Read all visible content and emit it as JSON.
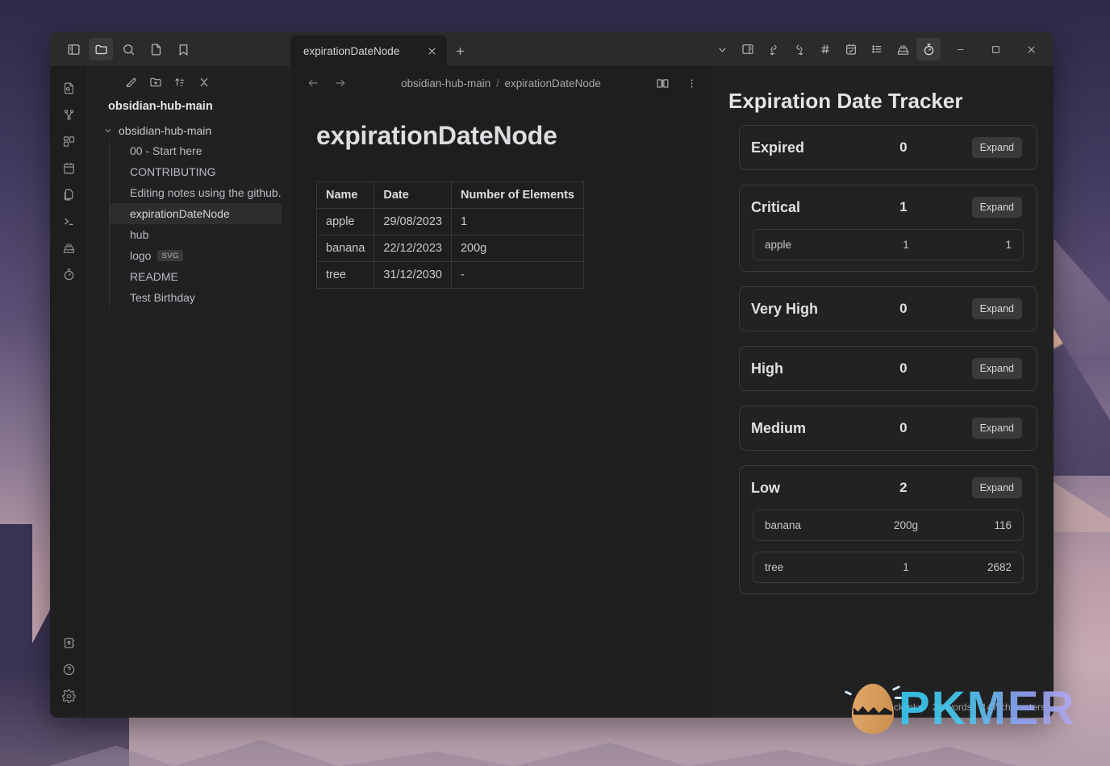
{
  "window": {
    "controls": {
      "minimize": "minimize-icon",
      "maximize": "maximize-icon",
      "close": "close-icon"
    }
  },
  "sidebar_toolbar": {
    "items": [
      {
        "name": "toggle-left-sidebar-icon",
        "label": "Toggle left sidebar"
      },
      {
        "name": "folder-icon",
        "label": "Files",
        "active": true
      },
      {
        "name": "search-icon",
        "label": "Search"
      },
      {
        "name": "file-icon",
        "label": "Recent files"
      },
      {
        "name": "bookmark-icon",
        "label": "Bookmarks"
      }
    ]
  },
  "tabs": {
    "items": [
      {
        "title": "expirationDateNode",
        "active": true
      }
    ],
    "close_label": "×",
    "new_tab_label": "+"
  },
  "top_right_toolbar": {
    "items": [
      {
        "name": "chevron-down-icon",
        "label": "More options"
      },
      {
        "name": "toggle-right-sidebar-icon",
        "label": "Toggle right sidebar"
      },
      {
        "name": "link-back-icon",
        "label": "Backlinks"
      },
      {
        "name": "link-forward-icon",
        "label": "Outgoing links"
      },
      {
        "name": "hash-tag-icon",
        "label": "Tags"
      },
      {
        "name": "calendar-check-icon",
        "label": "Tasks"
      },
      {
        "name": "list-icon",
        "label": "Outline"
      },
      {
        "name": "cake-icon",
        "label": "Birthday tracker"
      },
      {
        "name": "timer-icon",
        "label": "Expiration date tracker",
        "active": true
      }
    ]
  },
  "ribbon": {
    "top_items": [
      {
        "name": "file-search-icon",
        "label": "Quick switcher"
      },
      {
        "name": "graph-icon",
        "label": "Graph view"
      },
      {
        "name": "canvas-icon",
        "label": "Canvas"
      },
      {
        "name": "calendar-icon",
        "label": "Daily note"
      },
      {
        "name": "copy-files-icon",
        "label": "Templates"
      },
      {
        "name": "terminal-icon",
        "label": "Terminal"
      },
      {
        "name": "cake-icon",
        "label": "Birthday"
      },
      {
        "name": "timer-icon",
        "label": "Expiration tracker"
      }
    ],
    "bottom_items": [
      {
        "name": "vault-icon",
        "label": "Open another vault"
      },
      {
        "name": "help-icon",
        "label": "Help"
      },
      {
        "name": "settings-gear-icon",
        "label": "Settings"
      }
    ]
  },
  "explorer": {
    "toolbar": [
      {
        "name": "new-note-icon",
        "label": "New note"
      },
      {
        "name": "new-folder-icon",
        "label": "New folder"
      },
      {
        "name": "sort-icon",
        "label": "Change sort order"
      },
      {
        "name": "collapse-all-icon",
        "label": "Collapse all"
      }
    ],
    "vault_name": "obsidian-hub-main",
    "folder": {
      "name": "obsidian-hub-main",
      "expanded": true,
      "children": [
        {
          "label": "00 - Start here",
          "ext": null,
          "selected": false
        },
        {
          "label": "CONTRIBUTING",
          "ext": null,
          "selected": false
        },
        {
          "label": "Editing notes using the github.dev ed…",
          "ext": null,
          "selected": false
        },
        {
          "label": "expirationDateNode",
          "ext": null,
          "selected": true
        },
        {
          "label": "hub",
          "ext": null,
          "selected": false
        },
        {
          "label": "logo",
          "ext": "SVG",
          "selected": false
        },
        {
          "label": "README",
          "ext": null,
          "selected": false
        },
        {
          "label": "Test Birthday",
          "ext": null,
          "selected": false
        }
      ]
    }
  },
  "editor": {
    "nav": {
      "back": "back-arrow-icon",
      "forward": "forward-arrow-icon"
    },
    "breadcrumb": {
      "root": "obsidian-hub-main",
      "separator": "/",
      "leaf": "expirationDateNode"
    },
    "header_icons": [
      {
        "name": "reading-view-icon",
        "label": "Reading view"
      },
      {
        "name": "more-options-icon",
        "label": "More options"
      }
    ],
    "note_title": "expirationDateNode",
    "table": {
      "headers": [
        "Name",
        "Date",
        "Number of Elements"
      ],
      "rows": [
        [
          "apple",
          "29/08/2023",
          "1"
        ],
        [
          "banana",
          "22/12/2023",
          "200g"
        ],
        [
          "tree",
          "31/12/2030",
          "-"
        ]
      ]
    }
  },
  "right_panel": {
    "title": "Expiration Date Tracker",
    "expand_label": "Expand",
    "groups": [
      {
        "label": "Expired",
        "count": "0",
        "items": []
      },
      {
        "label": "Critical",
        "count": "1",
        "items": [
          {
            "name": "apple",
            "middle": "1",
            "right": "1"
          }
        ]
      },
      {
        "label": "Very High",
        "count": "0",
        "items": []
      },
      {
        "label": "High",
        "count": "0",
        "items": []
      },
      {
        "label": "Medium",
        "count": "0",
        "items": []
      },
      {
        "label": "Low",
        "count": "2",
        "items": [
          {
            "name": "banana",
            "middle": "200g",
            "right": "116"
          },
          {
            "name": "tree",
            "middle": "1",
            "right": "2682"
          }
        ]
      }
    ]
  },
  "status_bar": {
    "backlinks": "0 backlinks",
    "words": "23 words",
    "characters": "147 characters"
  },
  "watermark": {
    "text": "PKMER"
  },
  "colors": {
    "window_bg": "#1e1e1e",
    "panel_bg": "#212121",
    "titlebar_bg": "#2b2b2b",
    "border": "#3b3b3b",
    "text": "#dcddde",
    "accent_watermark": "#36c6ef"
  }
}
